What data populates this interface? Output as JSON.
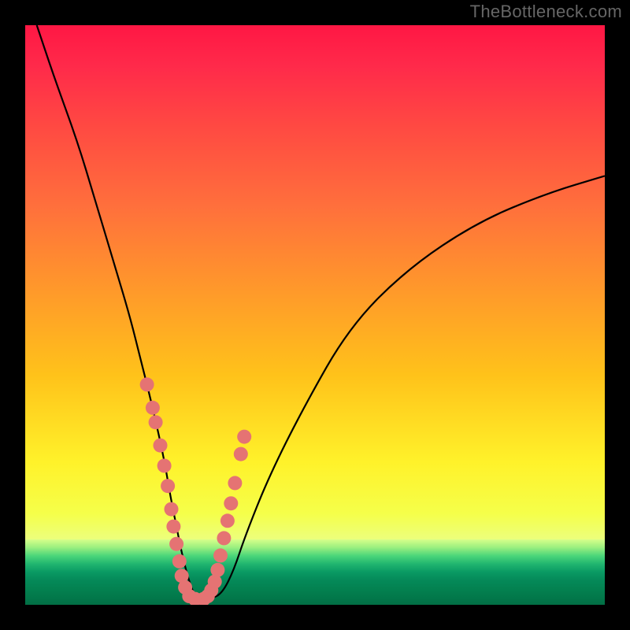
{
  "watermark": "TheBottleneck.com",
  "colors": {
    "background_frame": "#000000",
    "gradient_top": "#ff1744",
    "gradient_mid": "#ffb400",
    "gradient_low": "#fbff3a",
    "green_band": "#0a9a63",
    "curve": "#000000",
    "markers": "#e57373"
  },
  "chart_data": {
    "type": "line",
    "title": "",
    "xlabel": "",
    "ylabel": "",
    "xlim": [
      0,
      100
    ],
    "ylim": [
      0,
      100
    ],
    "grid": false,
    "legend": false,
    "series": [
      {
        "name": "bottleneck-curve",
        "x": [
          2,
          5,
          9,
          12,
          15,
          18,
          20,
          22,
          24,
          25,
          26,
          27,
          28,
          29,
          30,
          32,
          34,
          36,
          38,
          42,
          48,
          56,
          66,
          78,
          90,
          100
        ],
        "y": [
          100,
          91,
          80,
          70,
          60,
          50,
          42,
          34,
          25,
          19,
          14,
          9,
          5,
          2,
          1,
          1,
          2,
          6,
          12,
          22,
          34,
          48,
          58,
          66,
          71,
          74
        ]
      }
    ],
    "markers": {
      "name": "highlighted-points",
      "note": "clustered near the valley minimum on both branches",
      "x": [
        21.0,
        22.0,
        22.5,
        23.3,
        24.0,
        24.6,
        25.2,
        25.6,
        26.1,
        26.6,
        27.0,
        27.6,
        28.3,
        29.3,
        30.8,
        31.5,
        32.1,
        32.7,
        33.2,
        33.7,
        34.3,
        34.9,
        35.5,
        36.2,
        37.2,
        37.8
      ],
      "y": [
        38.0,
        34.0,
        31.5,
        27.5,
        24.0,
        20.5,
        16.5,
        13.5,
        10.5,
        7.5,
        5.0,
        3.0,
        1.5,
        1.0,
        1.0,
        1.5,
        2.5,
        4.0,
        6.0,
        8.5,
        11.5,
        14.5,
        17.5,
        21.0,
        26.0,
        29.0
      ]
    },
    "minimum": {
      "x": 30,
      "y": 1
    }
  }
}
